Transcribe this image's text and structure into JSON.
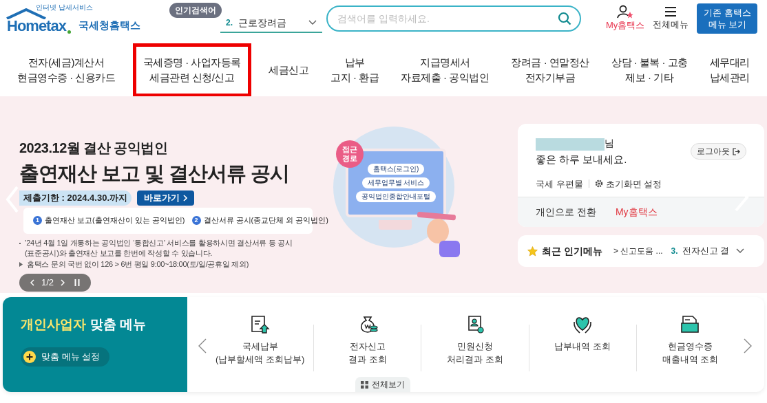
{
  "header": {
    "logo": {
      "tagline": "인터넷 납세서비스",
      "wordmark": "Hometax",
      "name": "국세청홈택스"
    },
    "popular_search": {
      "badge": "인기검색어",
      "rank": "2.",
      "term": "근로장려금"
    },
    "search": {
      "placeholder": "검색어를 입력하세요."
    },
    "my_hometax": "My홈택스",
    "all_menu": "전체메뉴",
    "classic_button": [
      "기존 홈택스",
      "메뉴 보기"
    ]
  },
  "nav": [
    {
      "lines": [
        "전자(세금)계산서",
        "현금영수증 · 신용카드"
      ],
      "highlighted": false
    },
    {
      "lines": [
        "국세증명 · 사업자등록",
        "세금관련 신청/신고"
      ],
      "highlighted": true
    },
    {
      "lines": [
        "세금신고"
      ],
      "highlighted": false
    },
    {
      "lines": [
        "납부",
        "고지 · 환급"
      ],
      "highlighted": false
    },
    {
      "lines": [
        "지급명세서",
        "자료제출 · 공익법인"
      ],
      "highlighted": false
    },
    {
      "lines": [
        "장려금 · 연말정산",
        "전자기부금"
      ],
      "highlighted": false
    },
    {
      "lines": [
        "상담 · 불복 · 고충",
        "제보 · 기타"
      ],
      "highlighted": false
    },
    {
      "lines": [
        "세무대리",
        "납세관리"
      ],
      "highlighted": false
    }
  ],
  "banner": {
    "title_small": "2023.12월 결산 공익법인",
    "title_large": "출연재산 보고 및 결산서류 공시",
    "deadline": "제출기한 : 2024.4.30.까지",
    "go_button": "바로가기",
    "steps": [
      {
        "number": "1",
        "text": "출연재산 보고(출연재산이 있는 공익법인)"
      },
      {
        "number": "2",
        "text": "결산서류 공시(종교단체 외 공익법인)"
      }
    ],
    "notes": [
      {
        "kind": "dot",
        "text": "’24년 4월 1일 개통하는 공익법인 ‘통합신고’ 서비스를 활용하시면 결산서류 등 공시(표준공시)와 출연재산 보고를 한번에 작성할 수 있습니다."
      },
      {
        "kind": "triangle",
        "text": "홈택스 문의 국번 없이 126 > 6번 평일 9:00~18:00(토/일/공휴일 제외)"
      }
    ],
    "pager": "1/2",
    "illustration": {
      "badge": [
        "접근",
        "경로"
      ],
      "steps": [
        "홈택스(로그인)",
        "세무업무별 서비스",
        "공익법인종합안내포털"
      ]
    }
  },
  "user_card": {
    "suffix": "님",
    "greeting": "좋은 하루 보내세요.",
    "logout": "로그아웃",
    "links": [
      "국세 우편물",
      "초기화면 설정"
    ],
    "switch": "개인으로 전환",
    "my_hometax": "My홈택스"
  },
  "popular_menu": {
    "label": "최근 인기메뉴",
    "item": "> 신고도움 ...",
    "rank": "3.",
    "term": "전자신고 결"
  },
  "custom_menu": {
    "title_highlight": "개인사업자",
    "title_rest": "맞춤 메뉴",
    "setting_button": "맞춤 메뉴 설정",
    "items": [
      {
        "kind": "document-upload",
        "lines": [
          "국세납부",
          "(납부할세액 조회납부)"
        ]
      },
      {
        "kind": "money-bag",
        "lines": [
          "전자신고",
          "결과 조회"
        ]
      },
      {
        "kind": "certificate",
        "lines": [
          "민원신청",
          "처리결과 조회"
        ]
      },
      {
        "kind": "heart-hands",
        "lines": [
          "납부내역 조회"
        ]
      },
      {
        "kind": "folder",
        "lines": [
          "현금영수증",
          "매출내역 조회"
        ]
      }
    ],
    "view_all": "전체보기"
  }
}
